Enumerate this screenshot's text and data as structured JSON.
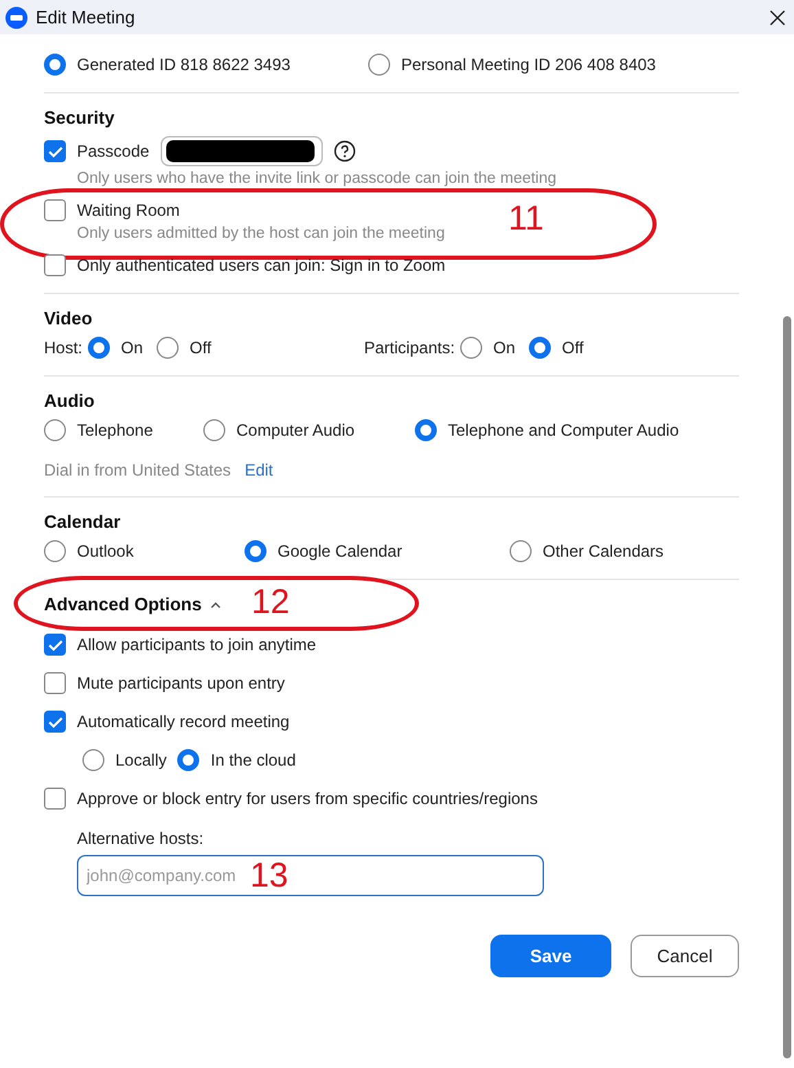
{
  "window": {
    "title": "Edit Meeting"
  },
  "meeting_id": {
    "options": [
      {
        "label": "Generated ID 818 8622 3493",
        "selected": true
      },
      {
        "label": "Personal Meeting ID 206 408 8403",
        "selected": false
      }
    ]
  },
  "security": {
    "heading": "Security",
    "items": [
      {
        "kind": "passcode",
        "label": "Passcode",
        "checked": true,
        "hint": "Only users who have the invite link or passcode can join the meeting"
      },
      {
        "kind": "checkbox",
        "label": "Waiting Room",
        "checked": false,
        "hint": "Only users admitted by the host can join the meeting",
        "annotation": "11"
      },
      {
        "kind": "checkbox",
        "label": "Only authenticated users can join: Sign in to Zoom",
        "checked": false
      }
    ]
  },
  "video": {
    "heading": "Video",
    "groups": [
      {
        "label": "Host:",
        "options": [
          {
            "label": "On",
            "selected": true
          },
          {
            "label": "Off",
            "selected": false
          }
        ]
      },
      {
        "label": "Participants:",
        "options": [
          {
            "label": "On",
            "selected": false
          },
          {
            "label": "Off",
            "selected": true
          }
        ]
      }
    ]
  },
  "audio": {
    "heading": "Audio",
    "options": [
      {
        "label": "Telephone",
        "selected": false
      },
      {
        "label": "Computer Audio",
        "selected": false
      },
      {
        "label": "Telephone and Computer Audio",
        "selected": true
      }
    ],
    "dial_in": {
      "text": "Dial in from United States",
      "link": "Edit"
    }
  },
  "calendar": {
    "heading": "Calendar",
    "options": [
      {
        "label": "Outlook",
        "selected": false
      },
      {
        "label": "Google Calendar",
        "selected": true
      },
      {
        "label": "Other Calendars",
        "selected": false
      }
    ]
  },
  "advanced": {
    "heading": "Advanced Options",
    "expanded": true,
    "annotation": "12",
    "items": [
      {
        "kind": "checkbox",
        "label": "Allow participants to join anytime",
        "checked": true
      },
      {
        "kind": "checkbox",
        "label": "Mute participants upon entry",
        "checked": false
      },
      {
        "kind": "checkbox",
        "label": "Automatically record meeting",
        "checked": true
      },
      {
        "kind": "radios",
        "options": [
          {
            "label": "Locally",
            "selected": false
          },
          {
            "label": "In the cloud",
            "selected": true
          }
        ]
      },
      {
        "kind": "checkbox",
        "label": "Approve or block entry for users from specific countries/regions",
        "checked": false
      }
    ],
    "alternative_hosts": {
      "label": "Alternative hosts:",
      "placeholder": "john@company.com",
      "annotation": "13"
    }
  },
  "buttons": [
    {
      "label": "Save",
      "kind": "primary"
    },
    {
      "label": "Cancel",
      "kind": "secondary"
    }
  ]
}
